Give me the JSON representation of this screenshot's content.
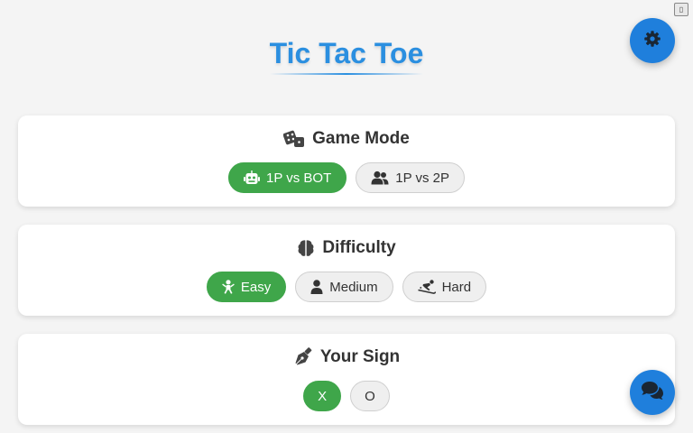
{
  "header": {
    "title": "Tic Tac Toe"
  },
  "corner_button": {
    "glyph": "▯"
  },
  "game_mode": {
    "title": "Game Mode",
    "icon": "dice-icon",
    "options": [
      {
        "label": "1P vs BOT",
        "icon": "robot-icon",
        "selected": true
      },
      {
        "label": "1P vs 2P",
        "icon": "users-icon",
        "selected": false
      }
    ]
  },
  "difficulty": {
    "title": "Difficulty",
    "icon": "brain-icon",
    "options": [
      {
        "label": "Easy",
        "icon": "baby-icon",
        "selected": true
      },
      {
        "label": "Medium",
        "icon": "person-icon",
        "selected": false
      },
      {
        "label": "Hard",
        "icon": "skiing-icon",
        "selected": false
      }
    ]
  },
  "your_sign": {
    "title": "Your Sign",
    "icon": "pen-nib-icon",
    "options": [
      {
        "label": "X",
        "selected": true
      },
      {
        "label": "O",
        "selected": false
      }
    ]
  },
  "fabs": {
    "settings_icon": "gear-icon",
    "chat_icon": "comments-icon"
  },
  "colors": {
    "accent_blue": "#1f7fdc",
    "title_blue": "#2b8fe0",
    "active_green": "#3fa64a"
  }
}
